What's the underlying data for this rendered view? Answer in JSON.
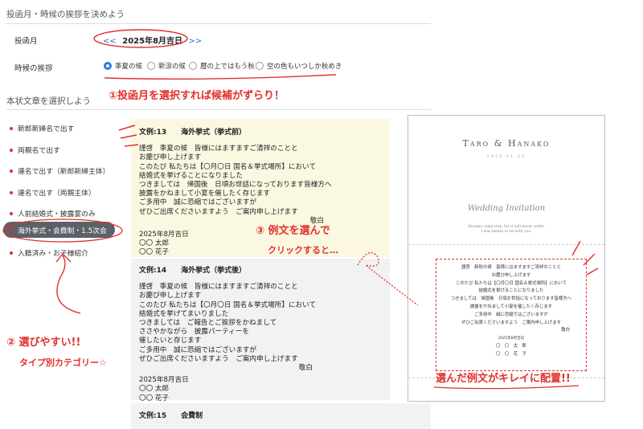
{
  "settings": {
    "title": "投函月・時候の挨拶を決めよう",
    "month_label": "投函月",
    "month_prev": "<<",
    "month_value": "2025年8月吉日",
    "month_next": ">>",
    "greeting_label": "時候の挨拶",
    "greetings": [
      "季夏の候",
      "新涼の候",
      "暦の上ではもう秋",
      "空の色もいつしか秋めき"
    ],
    "selected_greeting": 0
  },
  "text_section": {
    "title": "本状文章を選択しよう",
    "categories": [
      "新郎新婦名で出す",
      "両親名で出す",
      "連名で出す（新郎新婦主体）",
      "連名で出す（両親主体）",
      "人前結婚式・披露宴のみ",
      "海外挙式・会費制・1.5次会",
      "入籍済み・お子様紹介"
    ],
    "active_category": 5
  },
  "examples": [
    {
      "heading": "文例:13　　海外挙式（挙式前）",
      "body": "謹啓　季夏の候　皆様にはますますご清祥のことと\nお慶び申し上げます\nこのたび 私たちは【〇月〇日 国名＆挙式場所】において\n結婚式を挙げることになりました\nつきましては　帰国後　日頃お世話になっております皆様方へ\n披露をかねまして小宴を催したく存じます\nご多用中　誠に恐縮ではございますが\nぜひご出席くださいますよう　ご案内申し上げます",
      "closing": "敬白",
      "date": "2025年8月吉日",
      "name1": "〇〇 太郎",
      "name2": "〇〇 花子"
    },
    {
      "heading": "文例:14　　海外挙式（挙式後）",
      "body": "謹啓　季夏の候　皆様にはますますご清祥のことと\nお慶び申し上げます\nこのたび 私たちは【〇月〇日 国名＆挙式場所】において\n結婚式を挙げてまいりました\nつきましては　ご報告とご挨拶をかねまして\nささやかながら　披露パーティーを\n催したいと存じます\nご多用中　誠に恐縮ではございますが\nぜひご出席くださいますよう　ご案内申し上げます",
      "closing": "敬白",
      "date": "2025年8月吉日",
      "name1": "〇〇 太郎",
      "name2": "〇〇 花子"
    },
    {
      "heading": "文例:15　　会費制"
    }
  ],
  "annotations": {
    "note1": "①投函月を選択すれば候補がずらり！",
    "note2": "② 選びやすい!!",
    "note2b": "タイプ別カテゴリー☆",
    "note3a": "③ 例文を選んで",
    "note3b": "クリックすると…",
    "note4": "選んだ例文がキレイに配置!!"
  },
  "preview": {
    "names": "Taro & Hanako",
    "date": "2025.11.23",
    "signature": "Wedding Invitation",
    "tagline1": "Dreams come true, for it will never settle,",
    "tagline2": "I was meant to be with you.",
    "text_lines": [
      "謹啓　新秋の候　皆様にはますますご清祥のことと",
      "お慶び申し上げます",
      "このたび 私たちは【〇月〇日 国名＆挙式場所】において",
      "結婚式を挙げることになりました",
      "つきましては　帰国後　日頃お世話になっております皆様方へ",
      "披露をかねまして小宴を催したく存じます",
      "ご多用中　誠に恐縮ではございますが",
      "ぜひご出席くださいますよう　ご案内申し上げます"
    ],
    "closing": "敬白",
    "date_line": "2025年8月吉日",
    "name1": "〇　〇　太　郎",
    "name2": "〇　〇　花　子"
  },
  "colors": {
    "accent_red": "#e0302a",
    "radio_blue": "#2a7ae2",
    "card_yellow": "#fbf8e2",
    "card_gray": "#f2f2f2"
  }
}
